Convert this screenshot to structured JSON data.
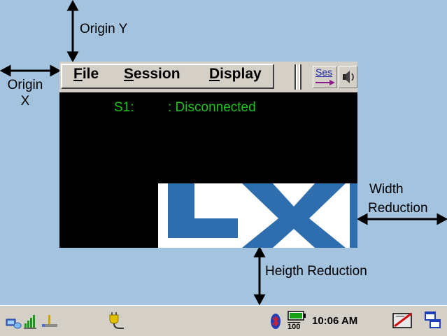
{
  "annotations": {
    "origin_y": "Origin Y",
    "origin_x_line1": "Origin",
    "origin_x_line2": "X",
    "width_reduction_line1": "Width",
    "width_reduction_line2": "Reduction",
    "height_reduction": "Heigth Reduction"
  },
  "menubar": {
    "file": {
      "mnemonic": "F",
      "rest": "ile"
    },
    "session": {
      "mnemonic": "S",
      "rest": "ession"
    },
    "display": {
      "mnemonic": "D",
      "rest": "isplay"
    }
  },
  "toolbar": {
    "session_button_label": "Ses",
    "speaker_icon": "speaker-icon"
  },
  "session": {
    "id": "S1:",
    "status": ": Disconnected",
    "status_color": "#19c619"
  },
  "logo": {
    "text": "LXE",
    "color": "#2f6eae"
  },
  "taskbar": {
    "network_icon": "network-icon",
    "signal_icon": "signal-strength-icon",
    "connection_icon": "connection-icon",
    "power_plug_icon": "power-plug-icon",
    "bluetooth_icon": "bluetooth-icon",
    "battery_icon": "battery-icon",
    "battery_label": "100",
    "clock": "10:06 AM",
    "input_panel_icon": "input-panel-icon",
    "window_switch_icon": "window-switch-icon"
  },
  "colors": {
    "desktop": "#a3c3df",
    "window_chrome": "#d4d0c8",
    "terminal_bg": "#000000"
  }
}
